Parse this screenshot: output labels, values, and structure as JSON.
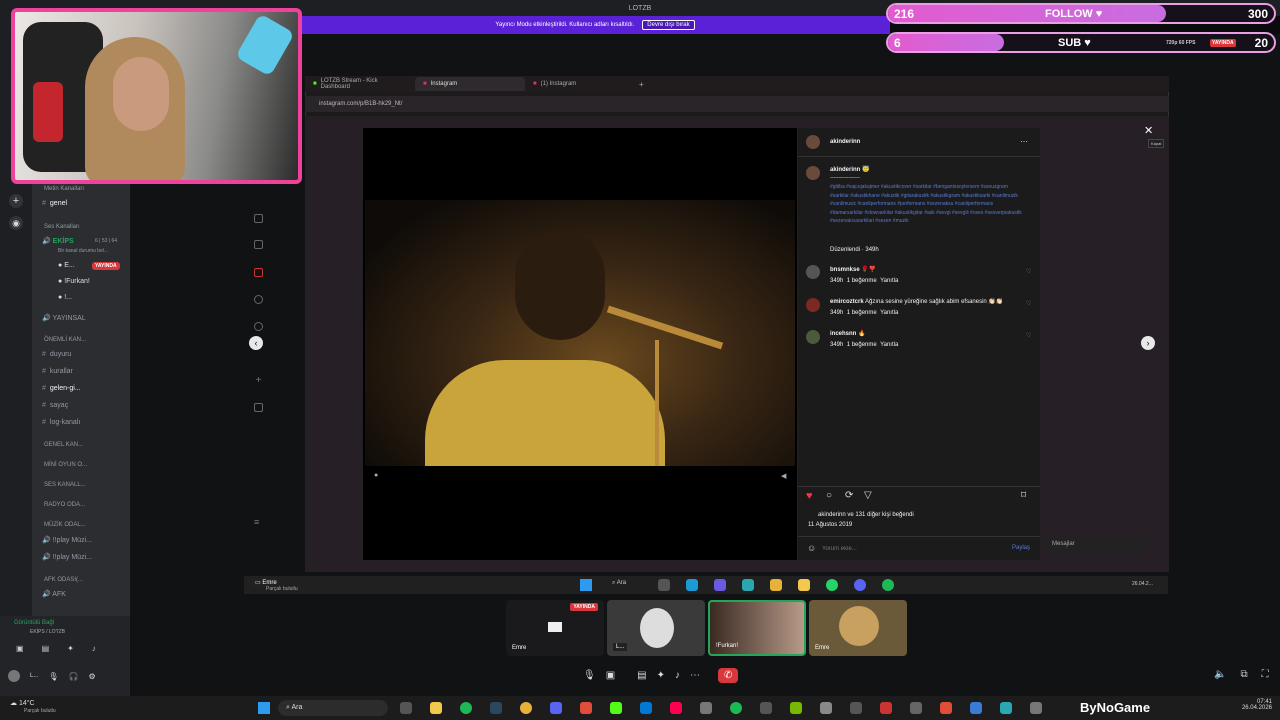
{
  "discord": {
    "window_title": "LOTZB",
    "mode_banner": {
      "text": "Yayıncı Modu etkinleştirildi. Kullanıcı adları kısaltıldı.",
      "button": "Devre dışı bırak"
    },
    "channels": {
      "text_category": "Metin Kanalları",
      "general": "genel",
      "voice_category": "Ses Kanalları",
      "ekips": {
        "name": "EKİPS",
        "count": "6 | 53 | 64",
        "sub": "Bir kanal durumu bel..."
      },
      "members": [
        {
          "name": "E...",
          "badge": "YAYINDA"
        },
        {
          "name": "!Furkan!"
        },
        {
          "name": "!..."
        }
      ],
      "yayinsal": "YAYINSAL",
      "important_cat": "ÖNEMLİ KAN...",
      "duyuru": "duyuru",
      "kurallar": "kurallar",
      "gelen": "gelen-gi...",
      "sayac": "sayaç",
      "log": "log-kanalı",
      "general_cat": "GENEL KAN...",
      "mini_cat": "MİNİ OYUN O...",
      "ses_cat": "SES KANALL...",
      "radyo_cat": "RADYO ODA...",
      "muzik_cat": "MÜZİK ODAL...",
      "play1": "!!play Müzi...",
      "play2": "!!play Müzi...",
      "afk_cat": "AFK ODASI(...",
      "afk": "AFK"
    },
    "voice_status": {
      "title": "Görüntülü Bağl",
      "sub": "EKİPS / LOTZB"
    },
    "user_panel": {
      "name": "L...",
      "status": "Yay..."
    },
    "stream_tiles": [
      {
        "name": "Emre",
        "badge": "YAYINDA"
      },
      {
        "name": "L..."
      },
      {
        "name": "!Furkan!"
      },
      {
        "name": "Emre"
      }
    ],
    "stream_label": "Emre",
    "stream_sub": "Parçalı bulutlu"
  },
  "overlay": {
    "follow": {
      "current": "216",
      "label": "FOLLOW ♥",
      "goal": "300",
      "progress": 0.72
    },
    "sub": {
      "current": "6",
      "label": "SUB ♥",
      "goal": "20",
      "progress": 0.3,
      "quality": "720p 60 FPS",
      "badge": "YAYINDA"
    }
  },
  "browser": {
    "tabs": [
      {
        "label": "LOTZB Stream - Kick Dashboard",
        "color": "#53fc18"
      },
      {
        "label": "Instagram",
        "color": "#e1306c"
      },
      {
        "label": "(1) Instagram",
        "color": "#e1306c"
      }
    ],
    "url": "instagram.com/p/B1B-hk29_Nt/"
  },
  "instagram": {
    "author": "akinderinn",
    "caption_user": "akinderinn",
    "caption_emoji": "😇",
    "caption_dashes": "------------------",
    "hashtags": "#gitiba #sajcojakajmer #akustikcover #sarkilar #benganiosoylersem #sseuzgram #sarkilar #akustikhane #akustik #gitarakustik #akustikgram #akustiksarki #canlimuzik #canlimusic #canliperformans #performans #sezenaksu #canliperformans #damarsarkilar #slowsarkilar #akustikgitar #ask #sevgi #sevgili #oses #sesverpiakustik #sezenaksusarkilari #sezen #muzik",
    "edited": "Düzenlendi · 349h",
    "comments": [
      {
        "user": "bnsmnkse",
        "text": "🌹❣️",
        "time": "349h",
        "likes": "1 beğenme",
        "reply": "Yanıtla"
      },
      {
        "user": "emircoztcrk",
        "text": "Ağzına sesine yüreğine sağlık abim efsanesin 👏🏻👏🏻",
        "time": "349h",
        "likes": "1 beğenme",
        "reply": "Yanıtla"
      },
      {
        "user": "incehsnn",
        "text": "🔥",
        "time": "349h",
        "likes": "1 beğenme",
        "reply": "Yanıtla"
      }
    ],
    "likes_text": "akinderinn ve 131 diğer kişi beğendi",
    "date": "11 Ağustos 2019",
    "comment_placeholder": "Yorum ekle...",
    "share_label": "Paylaş",
    "messages_label": "Mesajlar",
    "close_tooltip": "Kapat"
  },
  "inner_taskbar": {
    "search": "Ara",
    "date": "26.04.2..."
  },
  "windows_taskbar": {
    "weather": "14°C",
    "weather_sub": "Parçalı bulutlu",
    "search": "Ara",
    "brand": "ByNoGame",
    "time": "07:41",
    "date": "26.04.2026"
  }
}
